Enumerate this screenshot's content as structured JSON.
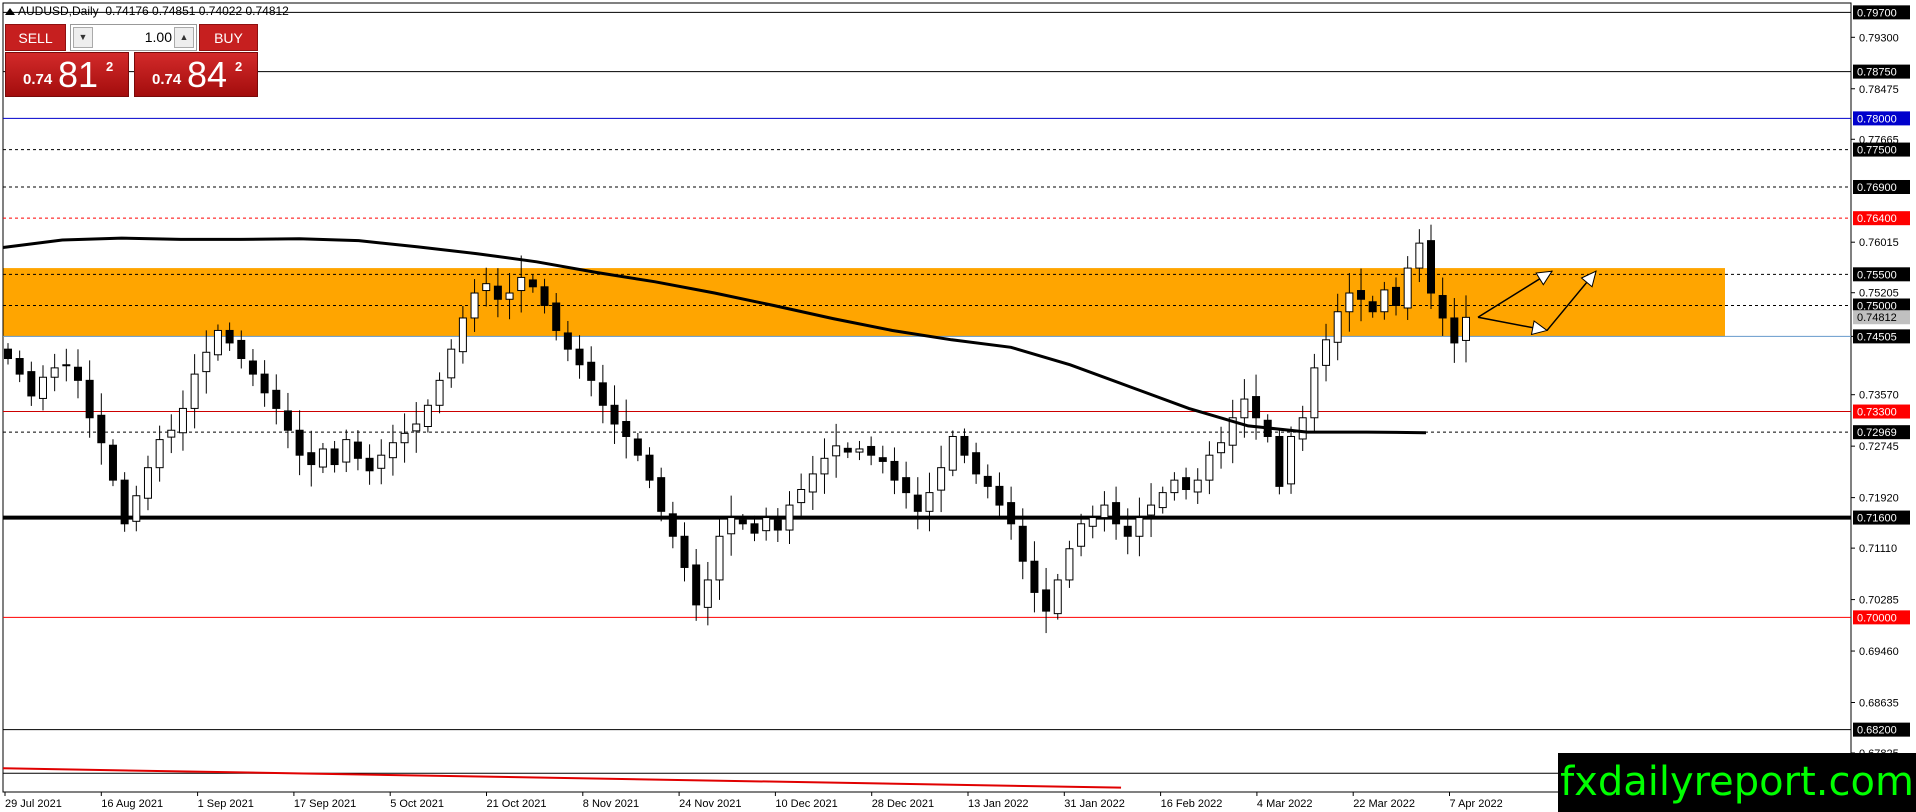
{
  "header": {
    "symbol_line": "AUDUSD,Daily  0.74176 0.74851 0.74022 0.74812"
  },
  "trade_panel": {
    "sell_label": "SELL",
    "buy_label": "BUY",
    "lot_size": "1.00",
    "sell_price": {
      "prefix": "0.74",
      "big": "81",
      "sup": "2"
    },
    "buy_price": {
      "prefix": "0.74",
      "big": "84",
      "sup": "2"
    }
  },
  "watermark": "fxdailyreport.com",
  "colors": {
    "zone": "#ffa500",
    "red_level": "#ff0000",
    "blue_level": "#0000cc",
    "ma": "#000000",
    "watermark_text": "#00ff00"
  },
  "chart_data": {
    "type": "candlestick",
    "symbol": "AUDUSD",
    "timeframe": "Daily",
    "ohlc_last": {
      "open": 0.74176,
      "high": 0.74851,
      "low": 0.74022,
      "close": 0.74812
    },
    "ylim": [
      0.672,
      0.7985
    ],
    "y_ticks": [
      "0.79300",
      "0.78475",
      "0.77665",
      "0.76015",
      "0.75205",
      "0.74505",
      "0.73570",
      "0.72745",
      "0.71920",
      "0.71110",
      "0.70285",
      "0.69460",
      "0.68635",
      "0.67825"
    ],
    "x_ticks": [
      "29 Jul 2021",
      "16 Aug 2021",
      "1 Sep 2021",
      "17 Sep 2021",
      "5 Oct 2021",
      "21 Oct 2021",
      "8 Nov 2021",
      "24 Nov 2021",
      "10 Dec 2021",
      "28 Dec 2021",
      "13 Jan 2022",
      "31 Jan 2022",
      "16 Feb 2022",
      "4 Mar 2022",
      "22 Mar 2022",
      "7 Apr 2022"
    ],
    "levels": [
      {
        "value": 0.797,
        "label": "0.79700",
        "style": "solid",
        "color": "#000000",
        "label_style": "black"
      },
      {
        "value": 0.7875,
        "label": "0.78750",
        "style": "solid",
        "color": "#000000",
        "label_style": "black"
      },
      {
        "value": 0.78,
        "label": "0.78000",
        "style": "solid",
        "color": "#0000cc",
        "label_style": "blue"
      },
      {
        "value": 0.775,
        "label": "0.77500",
        "style": "dashed",
        "color": "#000000",
        "label_style": "black"
      },
      {
        "value": 0.769,
        "label": "0.76900",
        "style": "dashed",
        "color": "#000000",
        "label_style": "black"
      },
      {
        "value": 0.764,
        "label": "0.76400",
        "style": "dashed",
        "color": "#ff0000",
        "label_style": "red"
      },
      {
        "value": 0.755,
        "label": "0.75500",
        "style": "dashed",
        "color": "#000000",
        "label_style": "black"
      },
      {
        "value": 0.75,
        "label": "0.75000",
        "style": "dashed",
        "color": "#000000",
        "label_style": "black"
      },
      {
        "value": 0.74505,
        "label": "0.74505",
        "style": "solid",
        "color": "#6699cc",
        "label_style": "black"
      },
      {
        "value": 0.733,
        "label": "0.73300",
        "style": "solid",
        "color": "#cc0000",
        "label_style": "red"
      },
      {
        "value": 0.72969,
        "label": "0.72969",
        "style": "dashed",
        "color": "#000000",
        "label_style": "black"
      },
      {
        "value": 0.716,
        "label": "0.71600",
        "style": "solid",
        "color": "#000000",
        "label_style": "black",
        "bold": true
      },
      {
        "value": 0.7,
        "label": "0.70000",
        "style": "solid",
        "color": "#ff0000",
        "label_style": "red"
      },
      {
        "value": 0.682,
        "label": "0.68200",
        "style": "solid",
        "color": "#000000",
        "label_style": "black"
      },
      {
        "value": 0.675,
        "label": "0.67500",
        "style": "solid",
        "color": "#000000",
        "label_style": "black"
      }
    ],
    "current_price": {
      "value": 0.74812,
      "label": "0.74812"
    },
    "zone": {
      "from": 0.745,
      "to": 0.756
    },
    "moving_average": {
      "values": [
        0.7593,
        0.7605,
        0.7608,
        0.7606,
        0.7606,
        0.7607,
        0.7604,
        0.7594,
        0.7583,
        0.757,
        0.7553,
        0.7538,
        0.752,
        0.75,
        0.7479,
        0.746,
        0.7445,
        0.7433,
        0.7405,
        0.737,
        0.7335,
        0.7307,
        0.7297,
        0.7297,
        0.7296
      ],
      "end_fraction": 0.77
    },
    "trendline": {
      "start": 0.6758,
      "end": 0.6727,
      "end_fraction": 0.605
    },
    "close_path": [
      0.7415,
      0.739,
      0.7355,
      0.7385,
      0.74,
      0.7405,
      0.738,
      0.732,
      0.728,
      0.722,
      0.715,
      0.7195,
      0.724,
      0.7285,
      0.73,
      0.7335,
      0.739,
      0.7425,
      0.746,
      0.744,
      0.7415,
      0.739,
      0.736,
      0.7335,
      0.73,
      0.726,
      0.7245,
      0.727,
      0.7245,
      0.7285,
      0.7255,
      0.7235,
      0.726,
      0.728,
      0.7295,
      0.731,
      0.734,
      0.738,
      0.743,
      0.748,
      0.752,
      0.7535,
      0.751,
      0.752,
      0.7545,
      0.753,
      0.75,
      0.746,
      0.743,
      0.7405,
      0.738,
      0.734,
      0.731,
      0.729,
      0.726,
      0.722,
      0.717,
      0.713,
      0.708,
      0.702,
      0.706,
      0.713,
      0.716,
      0.715,
      0.7135,
      0.716,
      0.714,
      0.718,
      0.7205,
      0.723,
      0.7255,
      0.7275,
      0.7265,
      0.727,
      0.726,
      0.725,
      0.722,
      0.72,
      0.717,
      0.72,
      0.724,
      0.729,
      0.726,
      0.723,
      0.721,
      0.718,
      0.715,
      0.709,
      0.704,
      0.701,
      0.706,
      0.711,
      0.715,
      0.716,
      0.718,
      0.715,
      0.713,
      0.716,
      0.718,
      0.72,
      0.722,
      0.7205,
      0.722,
      0.726,
      0.728,
      0.732,
      0.735,
      0.732,
      0.729,
      0.721,
      0.729,
      0.732,
      0.74,
      0.7445,
      0.749,
      0.752,
      0.751,
      0.749,
      0.7525,
      0.75,
      0.756,
      0.76,
      0.752,
      0.748,
      0.744,
      0.7481
    ]
  }
}
